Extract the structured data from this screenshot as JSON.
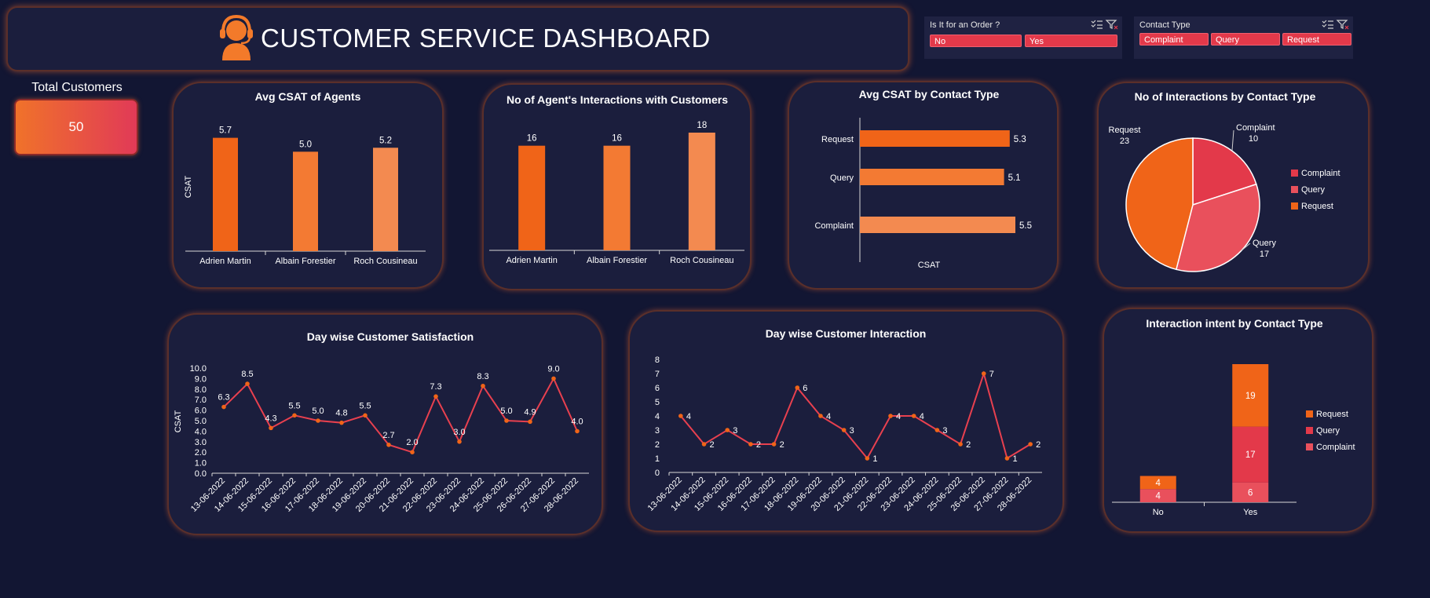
{
  "header": {
    "title": "CUSTOMER SERVICE DASHBOARD",
    "icon": "customer-support-agent-icon"
  },
  "slicers": [
    {
      "title": "Is It for an Order ?",
      "items": [
        "No",
        "Yes"
      ]
    },
    {
      "title": "Contact Type",
      "items": [
        "Complaint",
        "Query",
        "Request"
      ]
    }
  ],
  "kpi": {
    "label": "Total Customers",
    "value": "50"
  },
  "colors": {
    "background": "#121633",
    "card": "#1b1e3d",
    "orange_dark": "#f06418",
    "orange_mid": "#f37a33",
    "orange_light": "#f38a50",
    "red": "#e3394a",
    "red_light": "#e9505c",
    "line": "#e8404f",
    "slicer_button": "#e3394a"
  },
  "chart_data": [
    {
      "id": "avg-csat-agents",
      "type": "bar",
      "title": "Avg CSAT of Agents",
      "ylabel": "CSAT",
      "categories": [
        "Adrien Martin",
        "Albain Forestier",
        "Roch Cousineau"
      ],
      "values": [
        5.7,
        5.0,
        5.2
      ],
      "data_labels": [
        "5.7",
        "5.0",
        "5.2"
      ],
      "ylim": [
        0,
        6
      ],
      "bar_colors": [
        "#f06418",
        "#f37a33",
        "#f38a50"
      ]
    },
    {
      "id": "agent-interactions",
      "type": "bar",
      "title": "No of Agent's Interactions with Customers",
      "categories": [
        "Adrien Martin",
        "Albain Forestier",
        "Roch Cousineau"
      ],
      "values": [
        16,
        16,
        18
      ],
      "data_labels": [
        "16",
        "16",
        "18"
      ],
      "ylim": [
        0,
        18
      ],
      "bar_colors": [
        "#f06418",
        "#f37a33",
        "#f38a50"
      ]
    },
    {
      "id": "avg-csat-contact",
      "type": "bar",
      "orientation": "horizontal",
      "title": "Avg CSAT by Contact Type",
      "xlabel": "CSAT",
      "categories": [
        "Request",
        "Query",
        "Complaint"
      ],
      "values": [
        5.3,
        5.1,
        5.5
      ],
      "data_labels": [
        "5.3",
        "5.1",
        "5.5"
      ],
      "xlim": [
        0,
        5.5
      ],
      "bar_colors": [
        "#f06418",
        "#f37a33",
        "#f38a50"
      ]
    },
    {
      "id": "interactions-contact",
      "type": "pie",
      "title": "No of Interactions by Contact Type",
      "categories": [
        "Complaint",
        "Query",
        "Request"
      ],
      "values": [
        10,
        17,
        23
      ],
      "colors": [
        "#e3394a",
        "#e9505c",
        "#f06418"
      ],
      "legend": "right"
    },
    {
      "id": "day-csat",
      "type": "line",
      "title": "Day wise Customer Satisfaction",
      "ylabel": "CSAT",
      "x": [
        "13-06-2022",
        "14-06-2022",
        "15-06-2022",
        "16-06-2022",
        "17-06-2022",
        "18-06-2022",
        "19-06-2022",
        "20-06-2022",
        "21-06-2022",
        "22-06-2022",
        "23-06-2022",
        "24-06-2022",
        "25-06-2022",
        "26-06-2022",
        "27-06-2022",
        "28-06-2022"
      ],
      "values": [
        6.3,
        8.5,
        4.3,
        5.5,
        5.0,
        4.8,
        5.5,
        2.7,
        2.0,
        7.3,
        3.0,
        8.3,
        5.0,
        4.9,
        9.0,
        4.0
      ],
      "data_labels": [
        "6.3",
        "8.5",
        "4.3",
        "5.5",
        "5.0",
        "4.8",
        "5.5",
        "2.7",
        "2.0",
        "7.3",
        "3.0",
        "8.3",
        "5.0",
        "4.9",
        "9.0",
        "4.0"
      ],
      "ylim": [
        0,
        10
      ],
      "yticks": [
        "0.0",
        "1.0",
        "2.0",
        "3.0",
        "4.0",
        "5.0",
        "6.0",
        "7.0",
        "8.0",
        "9.0",
        "10.0"
      ]
    },
    {
      "id": "day-interactions",
      "type": "line",
      "title": "Day wise Customer Interaction",
      "x": [
        "13-06-2022",
        "14-06-2022",
        "15-06-2022",
        "16-06-2022",
        "17-06-2022",
        "18-06-2022",
        "19-06-2022",
        "20-06-2022",
        "21-06-2022",
        "22-06-2022",
        "23-06-2022",
        "24-06-2022",
        "25-06-2022",
        "26-06-2022",
        "27-06-2022",
        "28-06-2022"
      ],
      "values": [
        4,
        2,
        3,
        2,
        2,
        6,
        4,
        3,
        1,
        4,
        4,
        3,
        2,
        7,
        1,
        2
      ],
      "data_labels": [
        "4",
        "2",
        "3",
        "2",
        "2",
        "6",
        "4",
        "3",
        "1",
        "4",
        "4",
        "3",
        "2",
        "7",
        "1",
        "2"
      ],
      "ylim": [
        0,
        8
      ],
      "yticks": [
        "0",
        "1",
        "2",
        "3",
        "4",
        "5",
        "6",
        "7",
        "8"
      ]
    },
    {
      "id": "intent-contact",
      "type": "bar",
      "stacked": true,
      "title": "Interaction intent by Contact Type",
      "categories": [
        "No",
        "Yes"
      ],
      "series": [
        {
          "name": "Complaint",
          "values": [
            4,
            6
          ],
          "data_labels": [
            "4",
            "6"
          ],
          "color": "#e9505c"
        },
        {
          "name": "Query",
          "values": [
            0,
            17
          ],
          "data_labels": [
            "",
            "17"
          ],
          "color": "#e3394a"
        },
        {
          "name": "Request",
          "values": [
            4,
            19
          ],
          "data_labels": [
            "4",
            "19"
          ],
          "color": "#f06418"
        }
      ],
      "legend_order": [
        "Request",
        "Query",
        "Complaint"
      ],
      "legend": "right"
    }
  ]
}
